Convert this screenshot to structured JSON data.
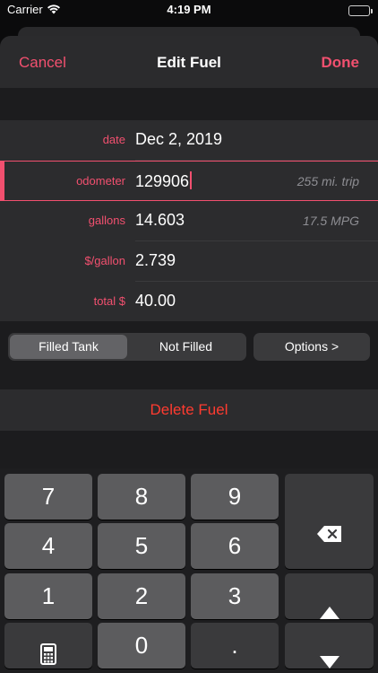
{
  "status": {
    "carrier": "Carrier",
    "time": "4:19 PM"
  },
  "nav": {
    "cancel": "Cancel",
    "title": "Edit Fuel",
    "done": "Done"
  },
  "form": {
    "date": {
      "label": "date",
      "value": "Dec 2, 2019"
    },
    "odometer": {
      "label": "odometer",
      "value": "129906",
      "aux": "255 mi. trip"
    },
    "gallons": {
      "label": "gallons",
      "value": "14.603",
      "aux": "17.5 MPG"
    },
    "price": {
      "label": "$/gallon",
      "value": "2.739"
    },
    "total": {
      "label": "total $",
      "value": "40.00"
    }
  },
  "segment": {
    "selected": "Filled Tank",
    "other": "Not Filled"
  },
  "options": "Options >",
  "delete": "Delete Fuel",
  "keypad": {
    "keys": [
      "7",
      "8",
      "9",
      "4",
      "5",
      "6",
      "1",
      "2",
      "3",
      "0",
      "."
    ],
    "icons": [
      "backspace-icon",
      "arrow-up-icon",
      "arrow-down-icon",
      "calculator-icon"
    ]
  },
  "colors": {
    "accent": "#f2506f",
    "destructive": "#ff3b30"
  }
}
